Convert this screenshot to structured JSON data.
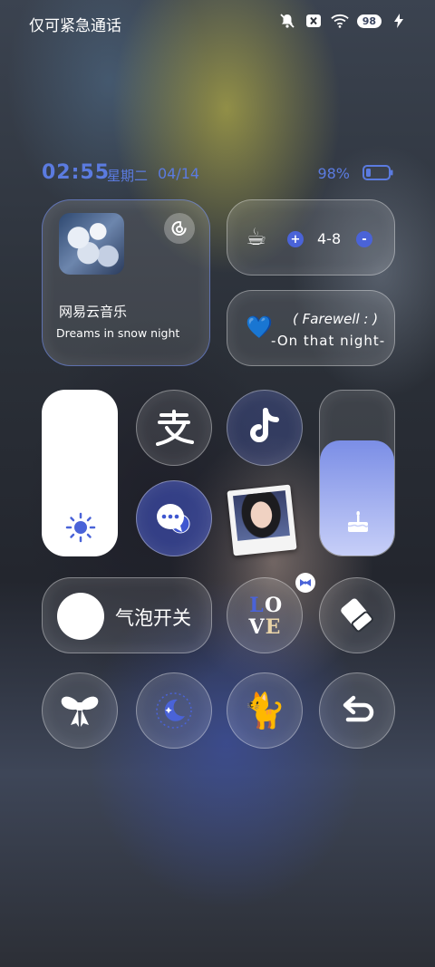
{
  "status_bar": {
    "carrier_text": "仅可紧急通话",
    "icons": [
      "bell-muted-icon",
      "no-sim-icon",
      "wifi-icon",
      "battery-icon",
      "charging-bolt-icon"
    ],
    "battery_level": "98"
  },
  "time_widget": {
    "time": "02:55",
    "weekday": "星期二",
    "date": "04/14",
    "battery_percent": "98%",
    "accent_color": "#5b7be0"
  },
  "music_widget": {
    "app_name": "网易云音乐",
    "song_title": "Dreams in snow night",
    "icons": [
      "album-art",
      "netease-music-icon"
    ]
  },
  "counter_widget": {
    "icon": "coffee-cup-icon",
    "plus_label": "+",
    "value": "4-8",
    "minus_label": "-"
  },
  "farewell_widget": {
    "icon": "blue-heart-icon",
    "line1": "( Farewell : )",
    "line2": "-On that night-"
  },
  "controls": {
    "brightness_icon": "sun-icon",
    "volume_level_fraction": 0.7,
    "volume_icon": "cake-icon",
    "bubble_switch_label": "气泡开关",
    "love_letters": [
      "L",
      "O",
      "V",
      "E"
    ],
    "app_icons": [
      "alipay-icon",
      "tiktok-icon",
      "chat-bubble-icon",
      "polaroid-photo",
      "eraser-icon",
      "bow-icon",
      "moon-icon",
      "cat-icon",
      "back-arrow-icon"
    ],
    "cat_emoji": "🐈",
    "coffee_emoji": "☕",
    "heart_emoji": "💙"
  },
  "colors": {
    "accent_blue": "#4a63d8",
    "volume_fill_top": "#7b8ee6",
    "volume_fill_bottom": "#c7cff8"
  }
}
